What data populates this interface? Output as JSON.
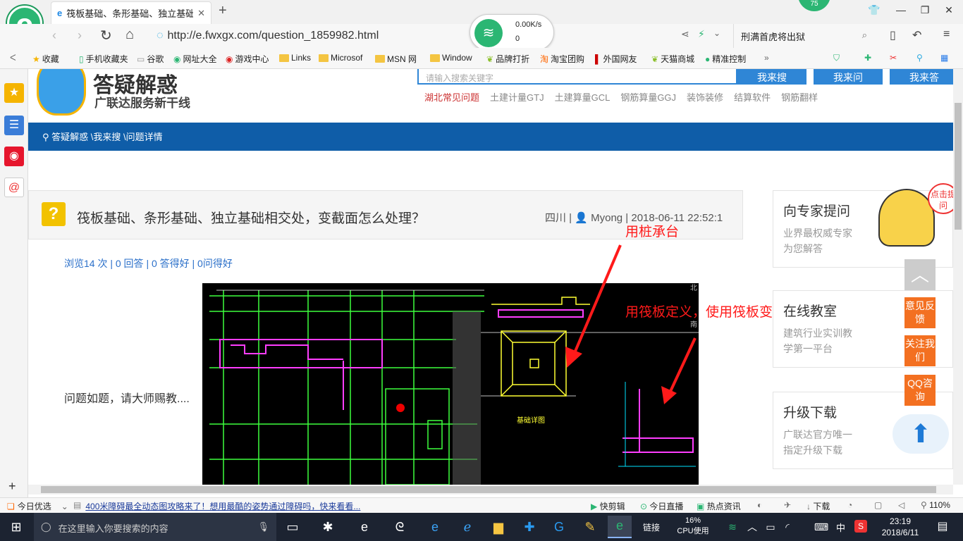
{
  "browser": {
    "tab_title": "筏板基础、条形基础、独立基础相",
    "url": "http://e.fwxgx.com/question_1859982.html",
    "search_text": "刑满首虎将出狱",
    "notif_badge": "75",
    "net_speed_up": "0.00K/s",
    "net_speed_down": "0",
    "bookmarks": [
      "收藏",
      "手机收藏夹",
      "谷歌",
      "网址大全",
      "游戏中心",
      "Links",
      "Microsof",
      "MSN 网",
      "Window",
      "品牌打折",
      "淘宝团购",
      "外国网友",
      "天猫商城",
      "精准控制"
    ]
  },
  "site": {
    "logo_title": "答疑解惑",
    "logo_subtitle": "广联达服务新干线",
    "search_placeholder": "请输入搜索关键字",
    "btn_search": "我来搜",
    "btn_ask": "我来问",
    "btn_answer": "我来答",
    "nav_links": [
      "湖北常见问题",
      "土建计量GTJ",
      "土建算量GCL",
      "钢筋算量GGJ",
      "装饰装修",
      "结算软件",
      "钢筋翻样"
    ],
    "breadcrumb": "答疑解惑 \\我来搜 \\问题详情"
  },
  "question": {
    "title": "筏板基础、条形基础、独立基础相交处，变截面怎么处理？",
    "region": "四川",
    "author": "Myong",
    "datetime": "2018-06-11 22:52:1",
    "stats": "浏览14 次 | 0 回答 | 0 答得好 | 0问得好",
    "body": "问题如题，请大师赐教....",
    "annotation_1": "用桩承台",
    "annotation_2": "用筏板定义，使用筏板变截面",
    "cad_label_1": "基础详图",
    "cad_label_2": "北",
    "cad_label_3": "南"
  },
  "sidebar": {
    "card1_title": "向专家提问",
    "card1_desc": "业界最权威专家\n为您解答",
    "card2_title": "在线教室",
    "card2_desc": "建筑行业实训教\n学第一平台",
    "card3_title": "升级下载",
    "card3_desc": "广联达官方唯一\n指定升级下载",
    "float_top_badge": "点击提问",
    "float_feedback": "意见反馈",
    "float_follow": "关注我们",
    "float_qq": "QQ咨询"
  },
  "statusbar": {
    "left_label": "今日优选",
    "news": "400米障碍最全动态图攻略来了！想用最酷的姿势通过障碍吗，快来看看...",
    "items": [
      "快剪辑",
      "今日直播",
      "热点资讯",
      "下载"
    ],
    "zoom": "110%"
  },
  "taskbar": {
    "search_placeholder": "在这里输入你要搜索的内容",
    "link_label": "链接",
    "cpu_value": "16%",
    "cpu_label": "CPU使用",
    "ime": "中",
    "time": "23:19",
    "date": "2018/6/11"
  },
  "colors": {
    "site_blue": "#0f5da8",
    "orange": "#f37021",
    "annotation_red": "#ff1a1a",
    "browser_green": "#2bb673"
  }
}
